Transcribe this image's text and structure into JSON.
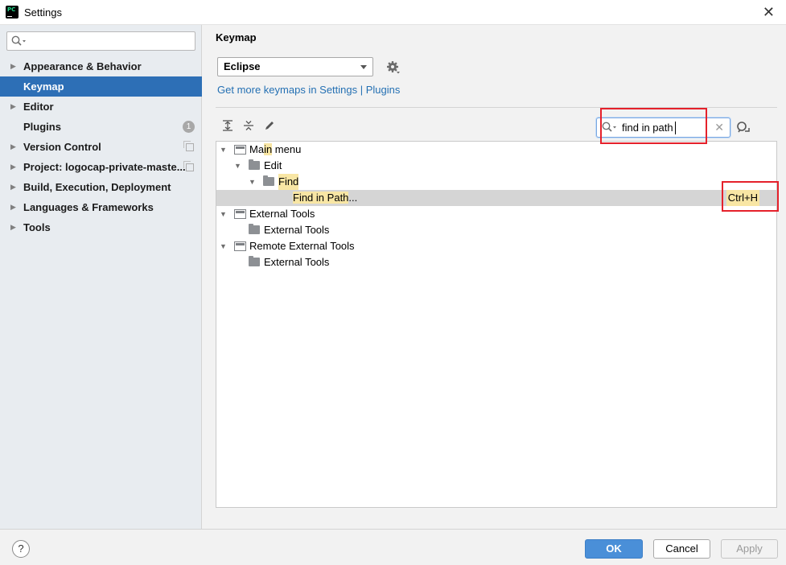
{
  "window": {
    "title": "Settings",
    "app_icon_text": "PC"
  },
  "sidebar": {
    "search": {
      "value": ""
    },
    "items": [
      {
        "label": "Appearance & Behavior",
        "expandable": true
      },
      {
        "label": "Keymap",
        "selected": true
      },
      {
        "label": "Editor",
        "expandable": true
      },
      {
        "label": "Plugins",
        "badge": "1"
      },
      {
        "label": "Version Control",
        "expandable": true
      },
      {
        "label": "Project: logocap-private-maste...",
        "expandable": true
      },
      {
        "label": "Build, Execution, Deployment",
        "expandable": true
      },
      {
        "label": "Languages & Frameworks",
        "expandable": true
      },
      {
        "label": "Tools",
        "expandable": true
      }
    ]
  },
  "main": {
    "title": "Keymap",
    "keymap_select": {
      "value": "Eclipse"
    },
    "more_link": "Get more keymaps in Settings | Plugins",
    "search": {
      "value": "find in path"
    },
    "tree": {
      "row1": {
        "pre": "Ma",
        "hl": "in",
        "post": " menu"
      },
      "row2": {
        "text": "Edit"
      },
      "row3": {
        "hl": "Find"
      },
      "row4": {
        "hl1": "Find",
        "sp1": " ",
        "hl2": "in",
        "sp2": " ",
        "hl3": "Path",
        "post": "...",
        "shortcut": "Ctrl+H"
      },
      "row5": {
        "text": "External Tools"
      },
      "row6": {
        "text": "External Tools"
      },
      "row7": {
        "text": "Remote External Tools"
      },
      "row8": {
        "text": "External Tools"
      }
    }
  },
  "footer": {
    "help": "?",
    "ok": "OK",
    "cancel": "Cancel",
    "apply": "Apply"
  },
  "colors": {
    "accent": "#2d6fb6",
    "highlight": "#f8e6a4",
    "annotation_red": "#e5212b",
    "link": "#2470b3"
  }
}
